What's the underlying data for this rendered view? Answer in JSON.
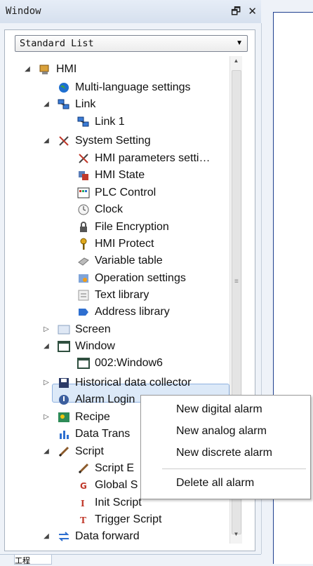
{
  "window": {
    "title": "Window",
    "pin": "🗗",
    "close": "✕"
  },
  "dropdown": {
    "value": "Standard List"
  },
  "tree": [
    {
      "label": "HMI",
      "expander": "◢",
      "icon": "hmi-icon"
    },
    {
      "label": "Multi-language settings",
      "icon": "globe-icon"
    },
    {
      "label": "Link",
      "expander": "◢",
      "icon": "link-icon"
    },
    {
      "label": "Link 1",
      "icon": "link-icon"
    },
    {
      "label": "System Setting",
      "expander": "◢",
      "icon": "tools-icon"
    },
    {
      "label": "HMI parameters setti…",
      "icon": "tools-icon"
    },
    {
      "label": "HMI State",
      "icon": "state-icon"
    },
    {
      "label": "PLC Control",
      "icon": "plc-icon"
    },
    {
      "label": "Clock",
      "icon": "clock-icon"
    },
    {
      "label": "File Encryption",
      "icon": "lock-icon"
    },
    {
      "label": "HMI Protect",
      "icon": "key-icon"
    },
    {
      "label": "Variable table",
      "icon": "table-icon"
    },
    {
      "label": "Operation settings",
      "icon": "settings-icon"
    },
    {
      "label": "Text library",
      "icon": "text-icon"
    },
    {
      "label": "Address library",
      "icon": "address-icon"
    },
    {
      "label": "Screen",
      "expander": "▷",
      "icon": "screen-icon"
    },
    {
      "label": "Window",
      "expander": "◢",
      "icon": "window-icon"
    },
    {
      "label": "002:Window6",
      "icon": "window-icon"
    },
    {
      "label": "Historical data collector",
      "expander": "▷",
      "icon": "save-icon"
    },
    {
      "label": "Alarm Login",
      "icon": "alarm-icon"
    },
    {
      "label": "Recipe",
      "expander": "▷",
      "icon": "recipe-icon"
    },
    {
      "label": "Data Trans",
      "icon": "chart-icon"
    },
    {
      "label": "Script",
      "expander": "◢",
      "icon": "pen-icon"
    },
    {
      "label": "Script E",
      "icon": "pen-icon"
    },
    {
      "label": "Global S",
      "icon": "script-g-icon"
    },
    {
      "label": "Init Script",
      "icon": "script-i-icon"
    },
    {
      "label": "Trigger Script",
      "icon": "script-t-icon"
    },
    {
      "label": "Data forward",
      "expander": "◢",
      "icon": "forward-icon"
    }
  ],
  "context_menu": {
    "items": [
      "New digital alarm",
      "New analog alarm",
      "New discrete alarm",
      "Delete all alarm"
    ]
  },
  "bottom_tab": {
    "label": "工程"
  }
}
